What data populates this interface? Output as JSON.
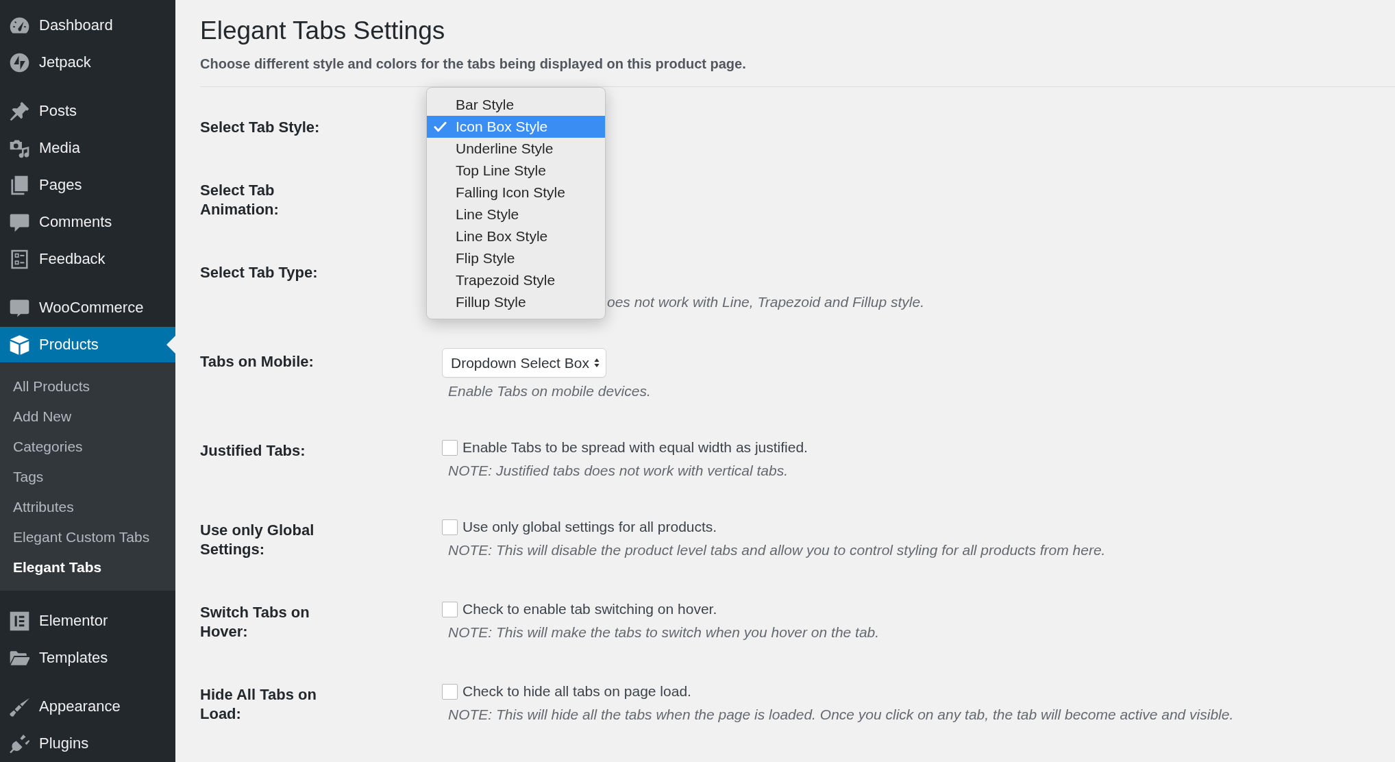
{
  "sidebar": {
    "groups": [
      {
        "items": [
          {
            "label": "Dashboard",
            "selected": false
          },
          {
            "label": "Jetpack",
            "selected": false
          }
        ]
      },
      {
        "items": [
          {
            "label": "Posts",
            "selected": false
          },
          {
            "label": "Media",
            "selected": false
          },
          {
            "label": "Pages",
            "selected": false
          },
          {
            "label": "Comments",
            "selected": false
          },
          {
            "label": "Feedback",
            "selected": false
          }
        ]
      },
      {
        "items": [
          {
            "label": "WooCommerce",
            "selected": false
          },
          {
            "label": "Products",
            "selected": true,
            "children": [
              {
                "label": "All Products",
                "selected": false
              },
              {
                "label": "Add New",
                "selected": false
              },
              {
                "label": "Categories",
                "selected": false
              },
              {
                "label": "Tags",
                "selected": false
              },
              {
                "label": "Attributes",
                "selected": false
              },
              {
                "label": "Elegant Custom Tabs",
                "selected": false
              },
              {
                "label": "Elegant Tabs",
                "selected": true
              }
            ]
          }
        ]
      },
      {
        "items": [
          {
            "label": "Elementor",
            "selected": false
          },
          {
            "label": "Templates",
            "selected": false
          }
        ]
      },
      {
        "items": [
          {
            "label": "Appearance",
            "selected": false
          },
          {
            "label": "Plugins",
            "selected": false
          }
        ]
      }
    ]
  },
  "page": {
    "title": "Elegant Tabs Settings",
    "description": "Choose different style and colors for the tabs being displayed on this product page."
  },
  "settings": [
    {
      "kind": "open-select",
      "label": "Select Tab Style:",
      "options": [
        {
          "label": "Bar Style",
          "selected": false
        },
        {
          "label": "Icon Box Style",
          "selected": true
        },
        {
          "label": "Underline Style",
          "selected": false
        },
        {
          "label": "Top Line Style",
          "selected": false
        },
        {
          "label": "Falling Icon Style",
          "selected": false
        },
        {
          "label": "Line Style",
          "selected": false
        },
        {
          "label": "Line Box Style",
          "selected": false
        },
        {
          "label": "Flip Style",
          "selected": false
        },
        {
          "label": "Trapezoid Style",
          "selected": false
        },
        {
          "label": "Fillup Style",
          "selected": false
        }
      ]
    },
    {
      "kind": "covered",
      "label": "Select Tab Animation:"
    },
    {
      "kind": "covered",
      "label": "Select Tab Type:",
      "note": "oes not work with Line, Trapezoid and Fillup style."
    },
    {
      "kind": "select",
      "label": "Tabs on Mobile:",
      "value": "Dropdown Select Box",
      "note": "Enable Tabs on mobile devices."
    },
    {
      "kind": "checkbox",
      "label": "Justified Tabs:",
      "checked": false,
      "text": "Enable Tabs to be spread with equal width as justified.",
      "note": "NOTE: Justified tabs does not work with vertical tabs."
    },
    {
      "kind": "checkbox",
      "label": "Use only Global Settings:",
      "checked": false,
      "text": "Use only global settings for all products.",
      "note": "NOTE: This will disable the product level tabs and allow you to control styling for all products from here."
    },
    {
      "kind": "checkbox",
      "label": "Switch Tabs on Hover:",
      "checked": false,
      "text": "Check to enable tab switching on hover.",
      "note": "NOTE: This will make the tabs to switch when you hover on the tab."
    },
    {
      "kind": "checkbox",
      "label": "Hide All Tabs on Load:",
      "checked": false,
      "text": "Check to hide all tabs on page load.",
      "note": "NOTE: This will hide all the tabs when the page is loaded. Once you click on any tab, the tab will become active and visible."
    }
  ]
}
